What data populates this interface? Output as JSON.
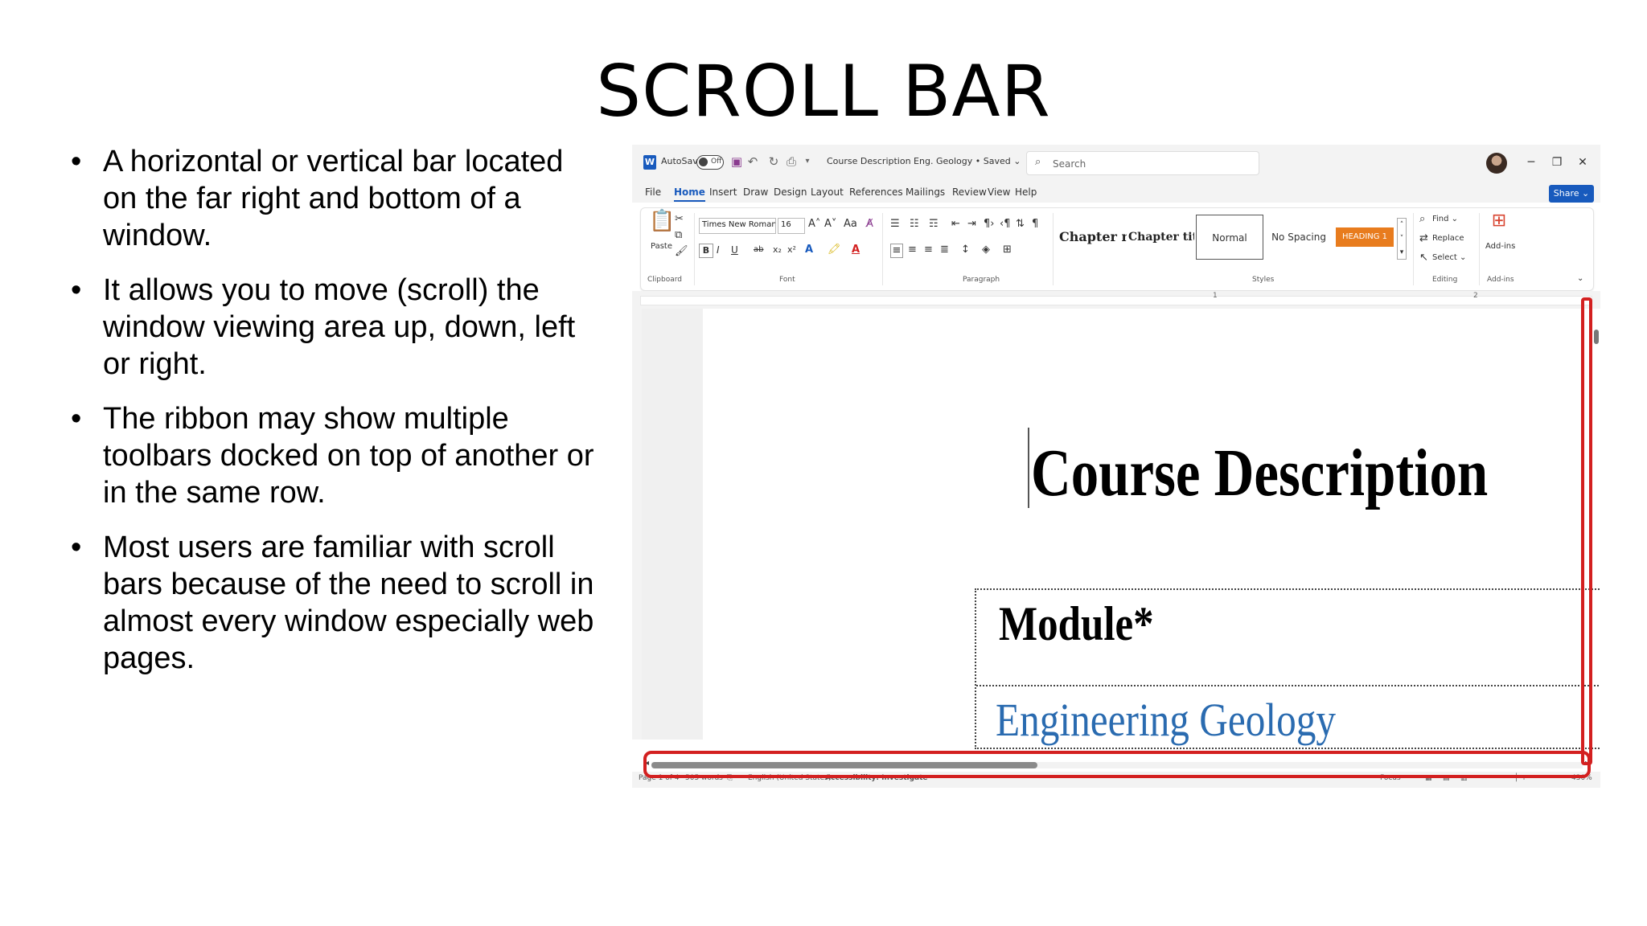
{
  "slide": {
    "title": "SCROLL BAR",
    "bullets": [
      "A horizontal or vertical bar located on the far right and bottom of a window.",
      "It allows you to move (scroll) the window viewing area up, down, left or right.",
      "The ribbon may show multiple toolbars docked on top of another or in the same row.",
      "Most users are familiar with scroll bars because of the need to scroll in almost every window especially web pages."
    ]
  },
  "word": {
    "titlebar": {
      "logo": "W",
      "autosave_label": "AutoSave",
      "autosave_state": "Off",
      "doc_title": "Course Description Eng. Geology • Saved ⌄",
      "search_placeholder": "Search",
      "minimize": "─",
      "restore": "❐",
      "close": "✕"
    },
    "tabs": [
      "File",
      "Home",
      "Insert",
      "Draw",
      "Design",
      "Layout",
      "References",
      "Mailings",
      "Review",
      "View",
      "Help"
    ],
    "active_tab": "Home",
    "share_label": "Share ⌄",
    "ribbon": {
      "clipboard": {
        "paste": "Paste",
        "group": "Clipboard"
      },
      "font": {
        "family": "Times New Roman (",
        "size": "16",
        "group": "Font",
        "buttons": [
          "B",
          "I",
          "U",
          "ab",
          "x₂",
          "x²",
          "A",
          "A"
        ]
      },
      "paragraph": {
        "group": "Paragraph"
      },
      "styles": {
        "group": "Styles",
        "items": [
          "Chapter n",
          "Chapter titl",
          "Normal",
          "No Spacing",
          "HEADING 1"
        ]
      },
      "editing": {
        "find": "Find ⌄",
        "replace": "Replace",
        "select": "Select ⌄",
        "group": "Editing"
      },
      "addins": {
        "label": "Add-ins",
        "group": "Add-ins"
      }
    },
    "ruler_numbers": [
      "1",
      "2"
    ],
    "document": {
      "title": "Course Description",
      "module_label": "Module*",
      "module_value": "Engineering Geology"
    },
    "status": {
      "page": "Page 1 of 4",
      "words": "505 words",
      "language": "English (United States)",
      "accessibility": "Accessibility: Investigate",
      "focus": "Focus",
      "zoom": "430%"
    }
  },
  "colors": {
    "word_blue": "#185abd",
    "highlight_red": "#d32020",
    "heading_orange": "#e87c1e",
    "geology_blue": "#2a6bb0"
  }
}
